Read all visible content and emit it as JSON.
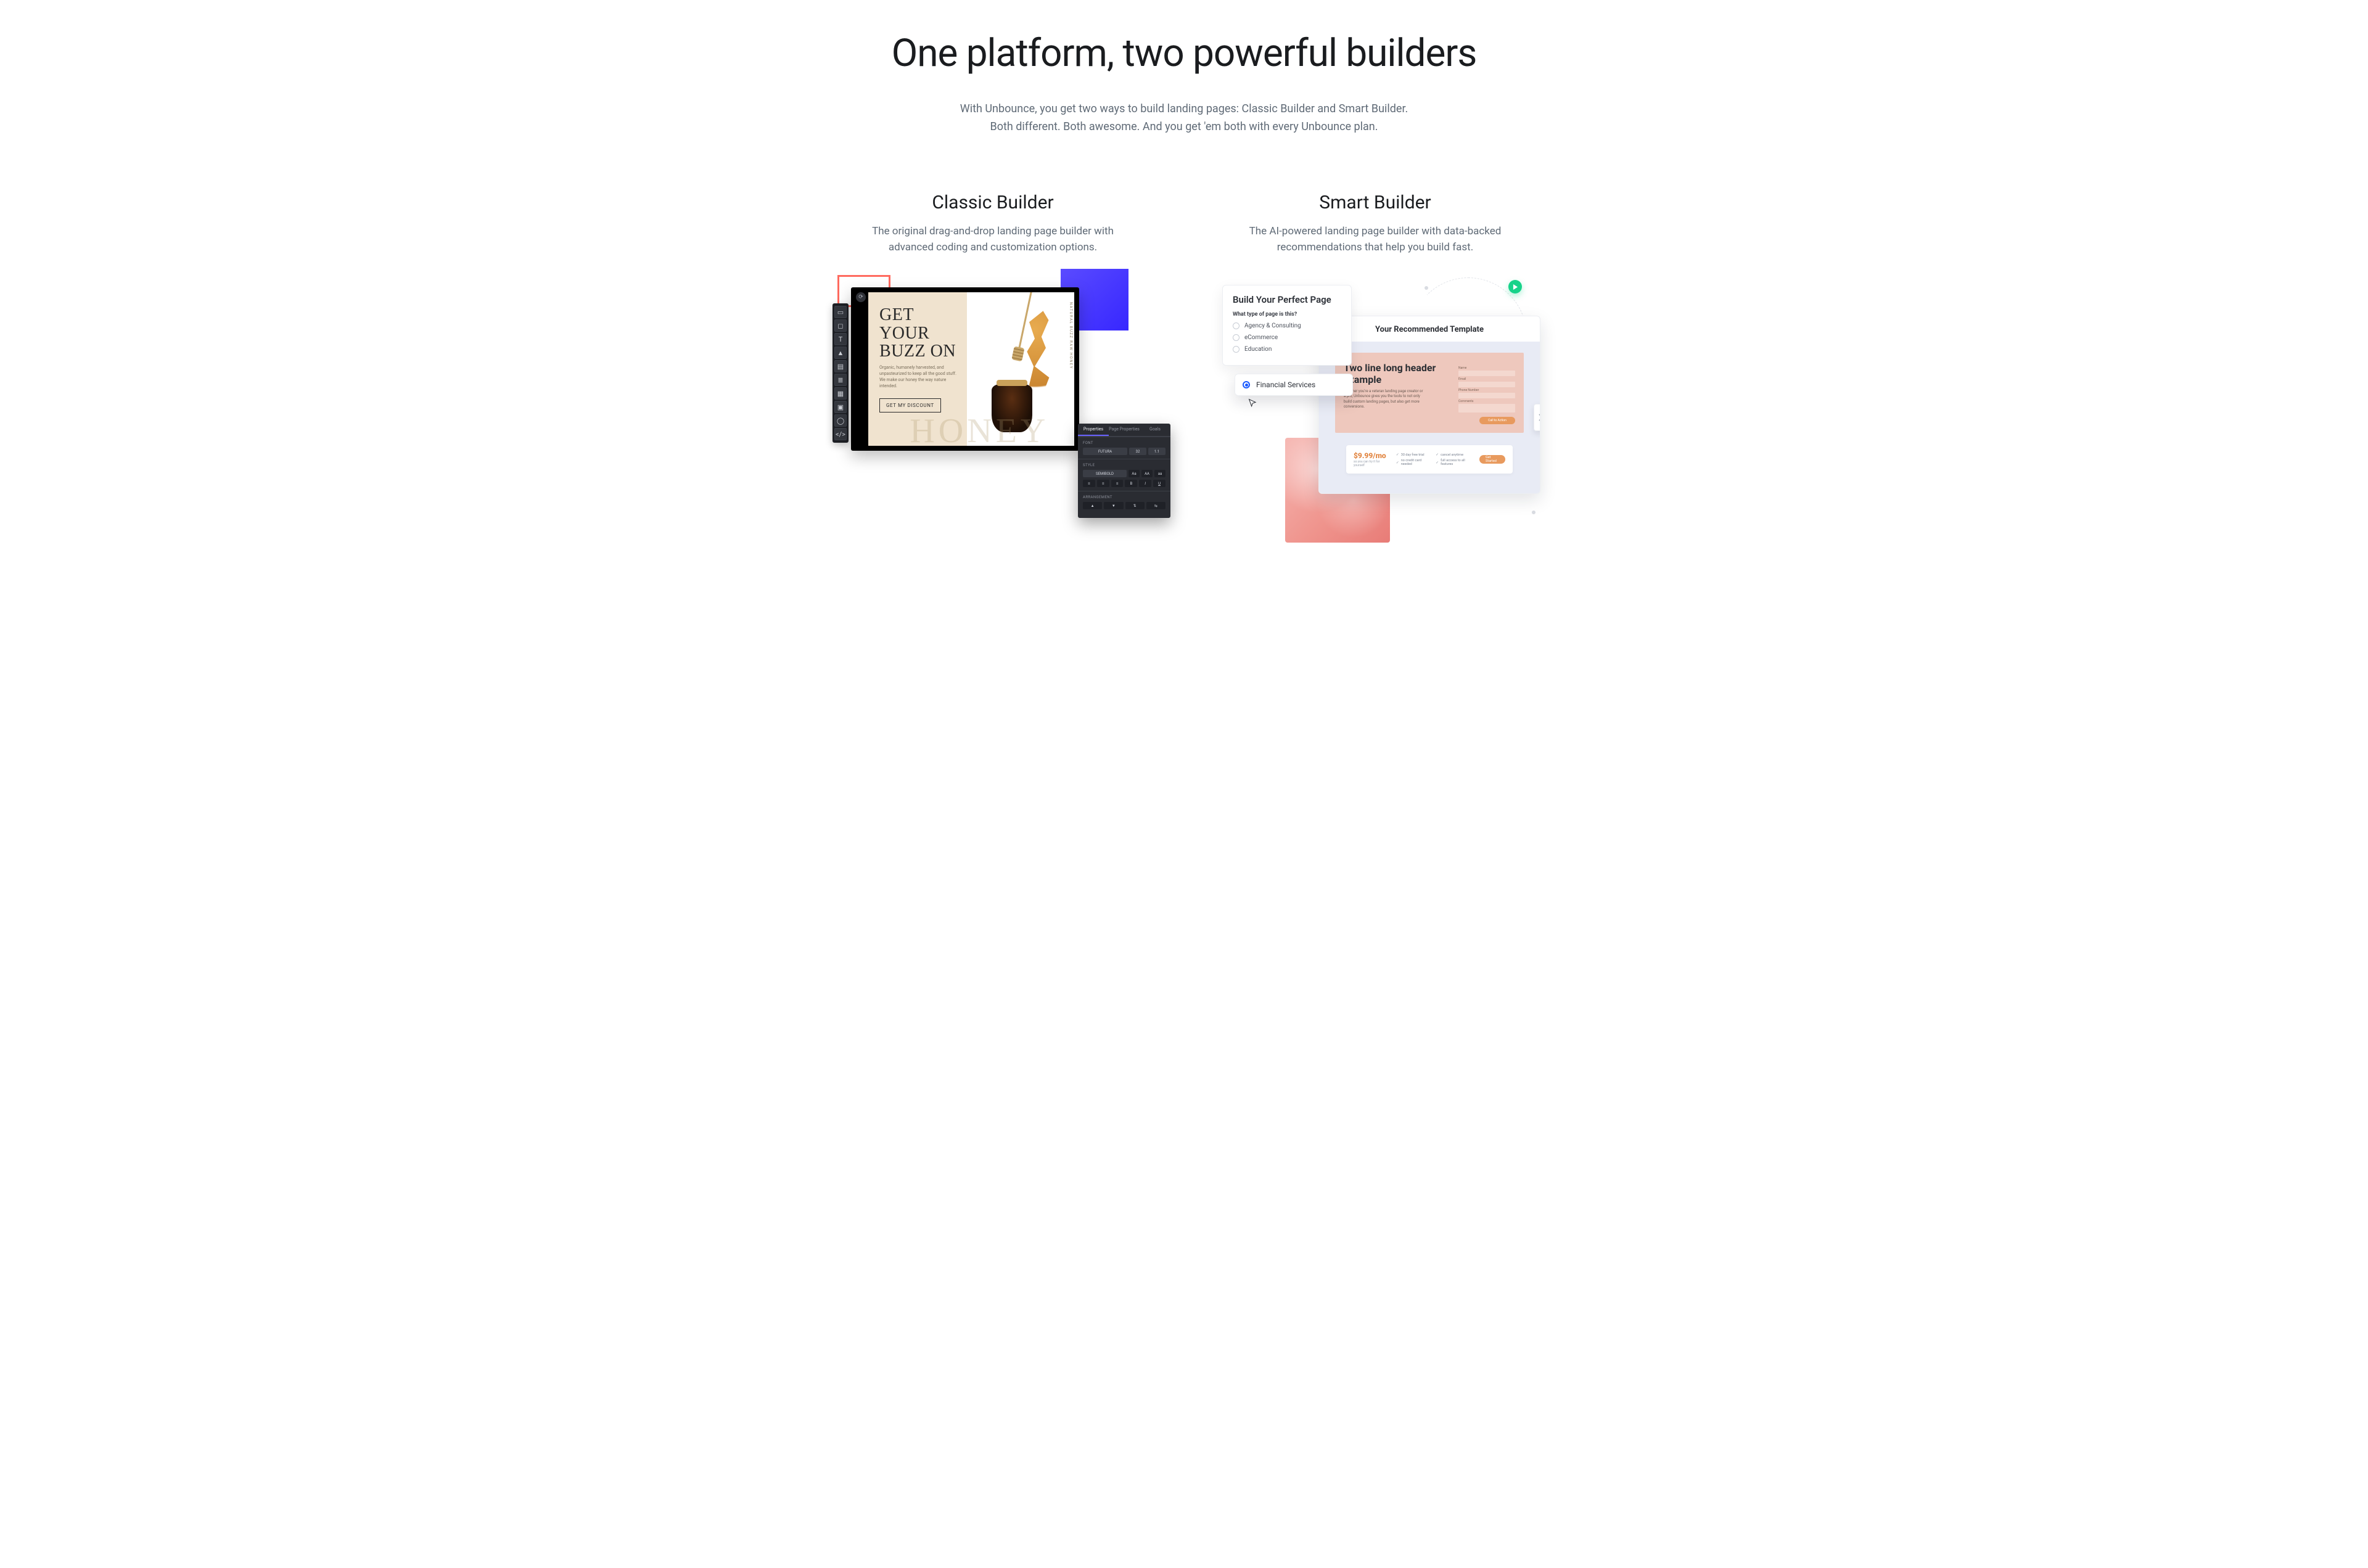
{
  "hero": {
    "title": "One platform, two powerful builders",
    "sub1": "With Unbounce, you get two ways to build landing pages: Classic Builder and Smart Builder.",
    "sub2": "Both different. Both awesome. And you get 'em both with every Unbounce plan."
  },
  "classic": {
    "title": "Classic Builder",
    "desc": "The original drag-and-drop landing page builder with advanced coding and customization options.",
    "lp": {
      "headline1": "GET YOUR",
      "headline2": "BUZZ ON",
      "body": "Organic, humanely harvested, and unpasteurized to keep all the good stuff. We make our honey the way nature intended.",
      "cta": "GET MY DISCOUNT",
      "sideText": "NATURAL BUZZ RAW HONEY",
      "watermark": "HONEY"
    },
    "toolbar_icons": [
      "section-icon",
      "box-icon",
      "text-icon",
      "image-icon",
      "form-icon",
      "list-icon",
      "row-icon",
      "video-icon",
      "embed-icon",
      "code-icon"
    ],
    "panel": {
      "tabs": [
        "Properties",
        "Page Properties",
        "Goals"
      ],
      "sections": {
        "font": {
          "label": "FONT",
          "family": "FUTURA",
          "size": "32",
          "height": "1.1"
        },
        "style": {
          "label": "STYLE",
          "weight": "SEMIBOLD",
          "caseOpts": [
            "Aa",
            "AA",
            "aa"
          ]
        },
        "arrangement": {
          "label": "ARRANGEMENT"
        }
      }
    }
  },
  "smart": {
    "title": "Smart Builder",
    "desc": "The AI-powered landing page builder with data-backed recommendations that help you build fast.",
    "wizard": {
      "title": "Build Your Perfect Page",
      "question": "What type of page is this?",
      "options": [
        "Agency & Consulting",
        "eCommerce",
        "Education"
      ],
      "selected": "Financial Services"
    },
    "template": {
      "heading": "Your Recommended Template",
      "hero_title": "Two line long header example",
      "hero_body": "Whether you're a veteran landing page creator or a pro, Unbounce gives you the tools to not only build custom landing pages, but also get more conversions.",
      "form": {
        "fields": [
          "Name",
          "Email",
          "Phone Number",
          "Comments"
        ],
        "cta": "Call to Action"
      },
      "pricing": {
        "price": "$9.99/mo",
        "sub": "so you can try it for yourself",
        "features": [
          "30 day free trial",
          "no credit card needed",
          "cancel anytime",
          "full access to all features"
        ],
        "cta": "Get Started"
      }
    }
  }
}
